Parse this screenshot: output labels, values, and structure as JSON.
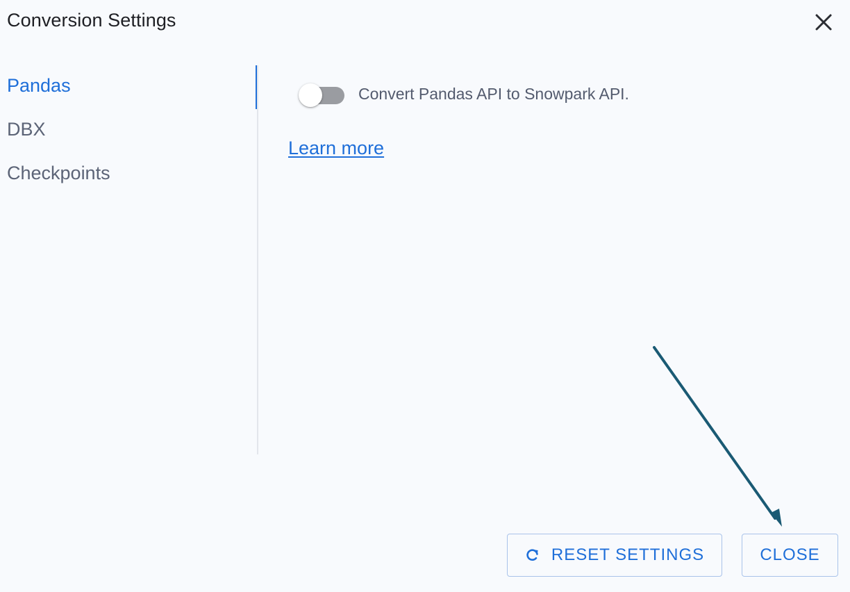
{
  "dialog": {
    "title": "Conversion Settings",
    "close_icon": "close-icon"
  },
  "sidebar": {
    "items": [
      {
        "label": "Pandas",
        "active": true
      },
      {
        "label": "DBX",
        "active": false
      },
      {
        "label": "Checkpoints",
        "active": false
      }
    ]
  },
  "main": {
    "toggle": {
      "label": "Convert Pandas API to Snowpark API.",
      "checked": false
    },
    "learn_more": "Learn more"
  },
  "footer": {
    "reset_label": "RESET SETTINGS",
    "reset_icon": "refresh-icon",
    "close_label": "CLOSE"
  },
  "colors": {
    "accent": "#1f6fd9",
    "annotation_arrow": "#1a5a74",
    "background": "#f8fafd"
  }
}
